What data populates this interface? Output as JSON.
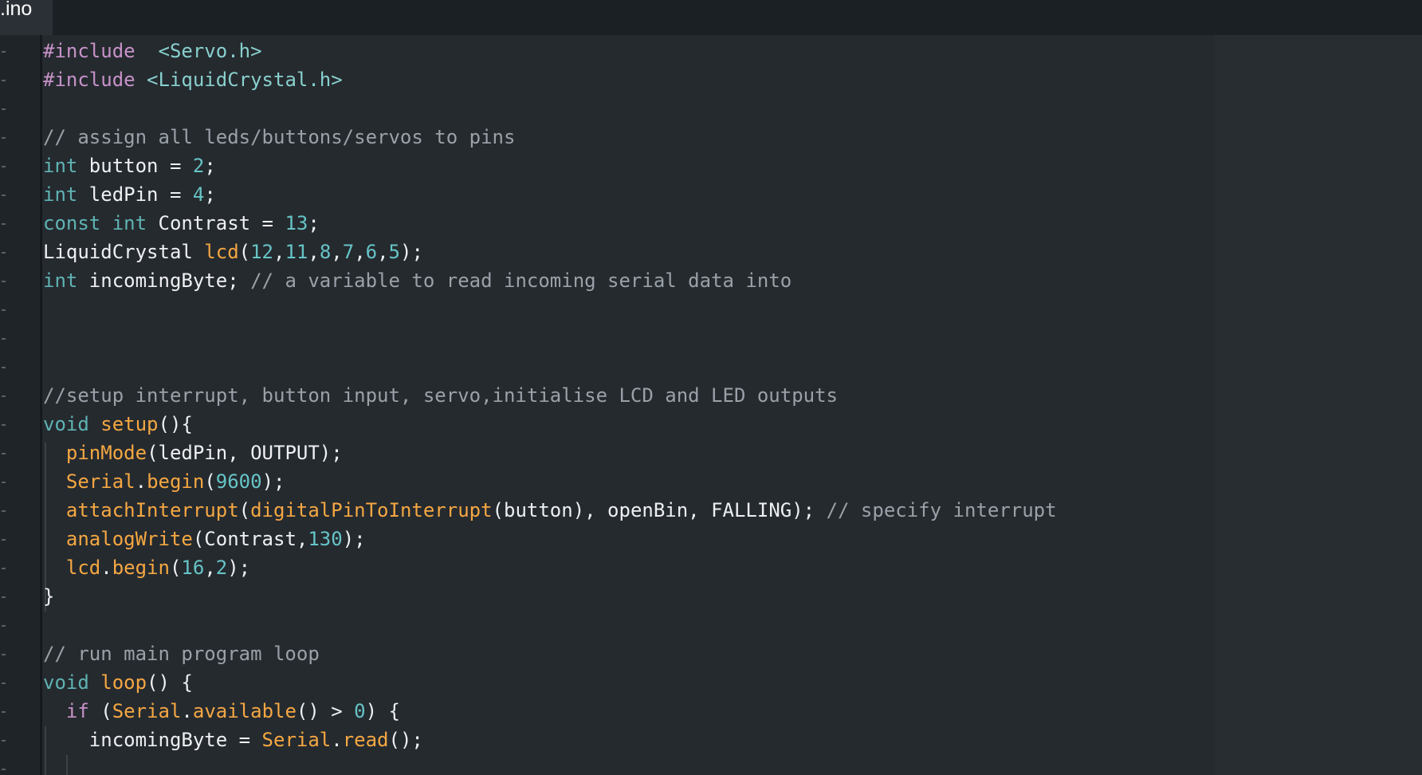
{
  "tab": {
    "title": ".ino"
  },
  "code": {
    "lines": [
      [
        [
          "kw",
          "#include"
        ],
        [
          "plain",
          "  "
        ],
        [
          "str",
          "<Servo.h>"
        ]
      ],
      [
        [
          "kw",
          "#include"
        ],
        [
          "plain",
          " "
        ],
        [
          "str",
          "<LiquidCrystal.h>"
        ]
      ],
      [],
      [
        [
          "cm",
          "// assign all leds/buttons/servos to pins"
        ]
      ],
      [
        [
          "ty",
          "int"
        ],
        [
          "plain",
          " button = "
        ],
        [
          "num",
          "2"
        ],
        [
          "plain",
          ";"
        ]
      ],
      [
        [
          "ty",
          "int"
        ],
        [
          "plain",
          " ledPin = "
        ],
        [
          "num",
          "4"
        ],
        [
          "plain",
          ";"
        ]
      ],
      [
        [
          "ty",
          "const"
        ],
        [
          "plain",
          " "
        ],
        [
          "ty",
          "int"
        ],
        [
          "plain",
          " Contrast = "
        ],
        [
          "num",
          "13"
        ],
        [
          "plain",
          ";"
        ]
      ],
      [
        [
          "plain",
          "LiquidCrystal "
        ],
        [
          "fn",
          "lcd"
        ],
        [
          "plain",
          "("
        ],
        [
          "num",
          "12"
        ],
        [
          "plain",
          ","
        ],
        [
          "num",
          "11"
        ],
        [
          "plain",
          ","
        ],
        [
          "num",
          "8"
        ],
        [
          "plain",
          ","
        ],
        [
          "num",
          "7"
        ],
        [
          "plain",
          ","
        ],
        [
          "num",
          "6"
        ],
        [
          "plain",
          ","
        ],
        [
          "num",
          "5"
        ],
        [
          "plain",
          ");"
        ]
      ],
      [
        [
          "ty",
          "int"
        ],
        [
          "plain",
          " incomingByte; "
        ],
        [
          "cm",
          "// a variable to read incoming serial data into"
        ]
      ],
      [],
      [],
      [],
      [
        [
          "cm",
          "//setup interrupt, button input, servo,initialise LCD and LED outputs"
        ]
      ],
      [
        [
          "ty",
          "void"
        ],
        [
          "plain",
          " "
        ],
        [
          "fn",
          "setup"
        ],
        [
          "plain",
          "(){"
        ]
      ],
      [
        [
          "plain",
          "  "
        ],
        [
          "fn",
          "pinMode"
        ],
        [
          "plain",
          "(ledPin, OUTPUT);"
        ]
      ],
      [
        [
          "plain",
          "  "
        ],
        [
          "fn",
          "Serial"
        ],
        [
          "plain",
          "."
        ],
        [
          "fn",
          "begin"
        ],
        [
          "plain",
          "("
        ],
        [
          "num",
          "9600"
        ],
        [
          "plain",
          ");"
        ]
      ],
      [
        [
          "plain",
          "  "
        ],
        [
          "fn",
          "attachInterrupt"
        ],
        [
          "plain",
          "("
        ],
        [
          "fn",
          "digitalPinToInterrupt"
        ],
        [
          "plain",
          "(button), openBin, FALLING); "
        ],
        [
          "cm",
          "// specify interrupt"
        ]
      ],
      [
        [
          "plain",
          "  "
        ],
        [
          "fn",
          "analogWrite"
        ],
        [
          "plain",
          "(Contrast,"
        ],
        [
          "num",
          "130"
        ],
        [
          "plain",
          ");"
        ]
      ],
      [
        [
          "plain",
          "  "
        ],
        [
          "fn",
          "lcd"
        ],
        [
          "plain",
          "."
        ],
        [
          "fn",
          "begin"
        ],
        [
          "plain",
          "("
        ],
        [
          "num",
          "16"
        ],
        [
          "plain",
          ","
        ],
        [
          "num",
          "2"
        ],
        [
          "plain",
          ");"
        ]
      ],
      [
        [
          "plain",
          "}"
        ]
      ],
      [],
      [
        [
          "cm",
          "// run main program loop"
        ]
      ],
      [
        [
          "ty",
          "void"
        ],
        [
          "plain",
          " "
        ],
        [
          "fn",
          "loop"
        ],
        [
          "plain",
          "() {"
        ]
      ],
      [
        [
          "plain",
          "  "
        ],
        [
          "kw",
          "if"
        ],
        [
          "plain",
          " ("
        ],
        [
          "fn",
          "Serial"
        ],
        [
          "plain",
          "."
        ],
        [
          "fn",
          "available"
        ],
        [
          "plain",
          "() > "
        ],
        [
          "num",
          "0"
        ],
        [
          "plain",
          ") {"
        ]
      ],
      [
        [
          "plain",
          "    incomingByte = "
        ],
        [
          "fn",
          "Serial"
        ],
        [
          "plain",
          "."
        ],
        [
          "fn",
          "read"
        ],
        [
          "plain",
          "();"
        ]
      ],
      []
    ]
  }
}
